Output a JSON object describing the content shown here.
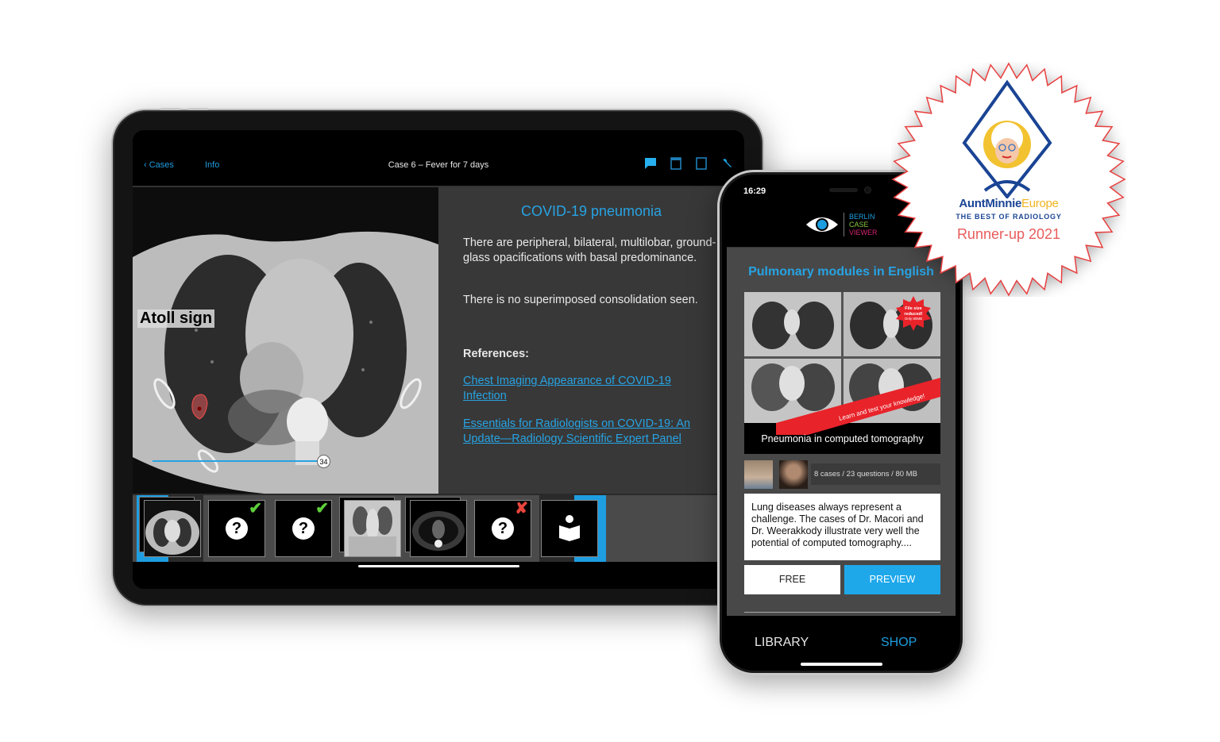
{
  "tablet": {
    "nav": {
      "back_label": "Cases",
      "info_label": "Info",
      "title": "Case 6 – Fever for 7 days",
      "icons": [
        "comment-icon",
        "window-icon",
        "square-icon",
        "wrench-icon"
      ]
    },
    "image": {
      "annotation_label": "Atoll sign",
      "slice_number": "34"
    },
    "info": {
      "diagnosis": "COVID-19 pneumonia",
      "paragraph_1": "There are peripheral, bilateral, multilobar, ground-glass opacifications with basal predominance.",
      "paragraph_2": "There is no superimposed consolidation seen.",
      "references_heading": "References:",
      "references": [
        "Chest Imaging Appearance of COVID-19 Infection",
        "Essentials for Radiologists on COVID-19: An Update—Radiology Scientific Expert Panel"
      ]
    },
    "filmstrip": [
      {
        "type": "ct-axial",
        "status": "selected"
      },
      {
        "type": "question",
        "status": "correct",
        "mark": "✔"
      },
      {
        "type": "question",
        "status": "correct",
        "mark": "✔"
      },
      {
        "type": "ct-coronal",
        "status": ""
      },
      {
        "type": "ct-axial-soft",
        "status": ""
      },
      {
        "type": "question",
        "status": "incorrect",
        "mark": "✘"
      },
      {
        "type": "reading",
        "status": "selected"
      }
    ]
  },
  "phone": {
    "status_time": "16:29",
    "logo": {
      "line1": "BERLIN",
      "line2": "CASE",
      "line3": "VIEWER"
    },
    "section_title": "Pulmonary modules in English",
    "module": {
      "cover_caption": "Pneumonia in computed tomography",
      "starburst_text": [
        "File size",
        "reduced!",
        "Only 80MB"
      ],
      "banner_text": "Learn and test your knowledge!",
      "meta": "8 cases / 23 questions / 80 MB",
      "description": "Lung diseases always represent a challenge. The cases of Dr. Macori and Dr. Weerakkody illustrate very well the potential of computed tomography....",
      "free_label": "FREE",
      "preview_label": "PREVIEW"
    },
    "tabs": [
      {
        "label": "LIBRARY",
        "active": false
      },
      {
        "label": "SHOP",
        "active": true
      }
    ]
  },
  "badge": {
    "brand_main": "AuntMinnie",
    "brand_eu": "Europe",
    "subtitle": "THE BEST OF RADIOLOGY",
    "award": "Runner-up 2021"
  },
  "colors": {
    "accent_blue": "#1e9de0",
    "correct_green": "#5ecf3a",
    "incorrect_red": "#e8453c",
    "logo_green": "#8cc63f",
    "logo_magenta": "#d6246e"
  }
}
